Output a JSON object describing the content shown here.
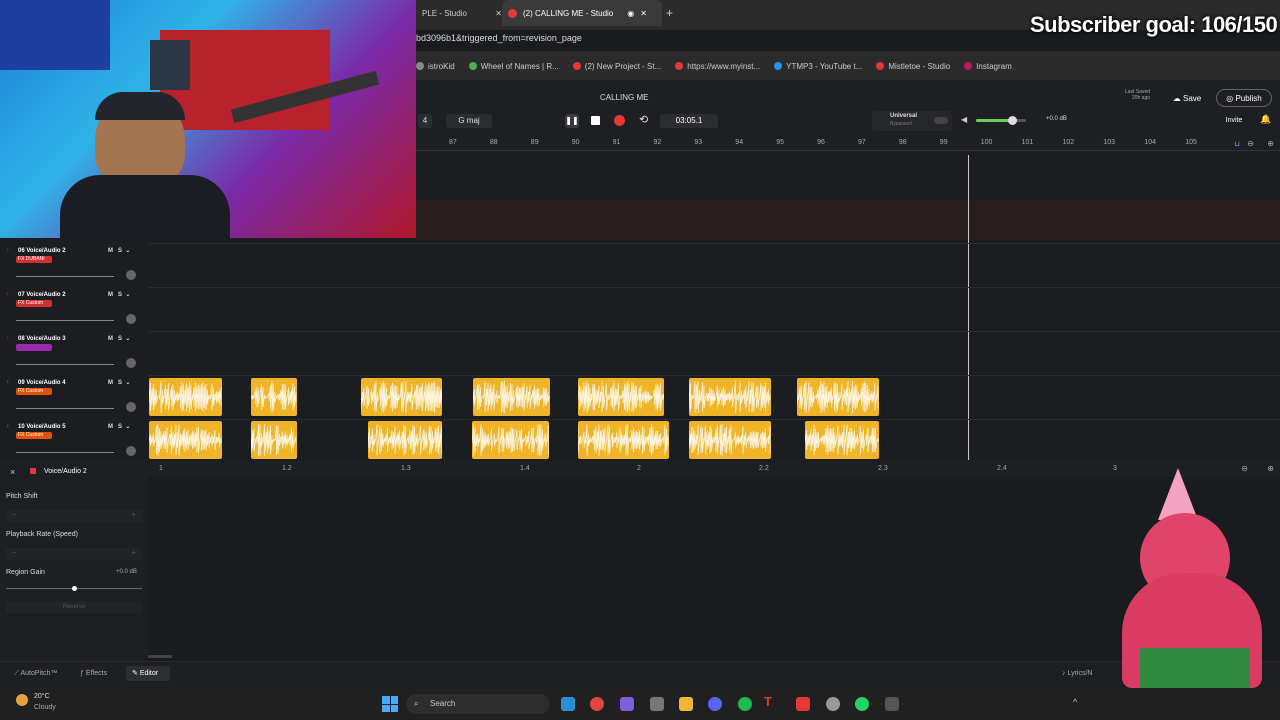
{
  "overlay": {
    "subscriber_goal": "Subscriber goal: 106/150"
  },
  "browser": {
    "tabs": [
      {
        "label": "PLE - Studio"
      },
      {
        "label": "(2) CALLING ME - Studio"
      }
    ],
    "new_tab": "+",
    "url": "bd3096b1&triggered_from=revision_page",
    "bookmarks": [
      {
        "label": "istroKid",
        "color": "#888"
      },
      {
        "label": "Wheel of Names | R...",
        "color": "#4caf50"
      },
      {
        "label": "(2) New Project - St...",
        "color": "#e53935"
      },
      {
        "label": "https://www.myinst...",
        "color": "#e53935"
      },
      {
        "label": "YTMP3 - YouTube t...",
        "color": "#2196f3"
      },
      {
        "label": "Mistletoe - Studio",
        "color": "#e53935"
      },
      {
        "label": "Instagram",
        "color": "#c2185b"
      }
    ]
  },
  "studio": {
    "project_title": "CALLING ME",
    "time_sig": "4",
    "key": "G maj",
    "time": "03:05.1",
    "plugin_name": "Universal",
    "plugin_state": "Bypassed",
    "master_db": "+0.0 dB",
    "last_saved_label": "Last Saved",
    "last_saved_time": "20h ago",
    "save_label": "Save",
    "publish_label": "Publish",
    "invite_label": "Invite",
    "ruler_ticks": [
      "87",
      "88",
      "89",
      "90",
      "91",
      "92",
      "93",
      "94",
      "95",
      "96",
      "97",
      "98",
      "99",
      "100",
      "101",
      "102",
      "103",
      "104",
      "105"
    ]
  },
  "tracks": [
    {
      "num": "06",
      "name": "Voice/Audio 2",
      "fx": "FX DUBANI",
      "fx_color": "#d32f2f"
    },
    {
      "num": "07",
      "name": "Voice/Audio 2",
      "fx": "FX Custom",
      "fx_color": "#d32f2f"
    },
    {
      "num": "08",
      "name": "Voice/Audio 3",
      "fx": "",
      "fx_color": "#9c27b0"
    },
    {
      "num": "09",
      "name": "Voice/Audio 4",
      "fx": "FX Custom",
      "fx_color": "#e65100"
    },
    {
      "num": "10",
      "name": "Voice/Audio 5",
      "fx": "FX Custom",
      "fx_color": "#e65100"
    }
  ],
  "track_buttons": {
    "mute": "M",
    "solo": "S"
  },
  "bottom_ruler": [
    "1",
    "1.2",
    "1.3",
    "1.4",
    "2",
    "2.2",
    "2.3",
    "2.4",
    "3"
  ],
  "editor": {
    "close": "×",
    "track_name": "Voice/Audio 2",
    "pitch_shift_label": "Pitch Shift",
    "playback_rate_label": "Playback Rate (Speed)",
    "region_gain_label": "Region Gain",
    "region_gain_value": "+0.0 dB",
    "reverse_label": "Reverse"
  },
  "bottom_tabs": {
    "autopitch": "AutoPitch™",
    "effects": "Effects",
    "editor": "Editor",
    "lyrics": "Lyrics/N"
  },
  "taskbar": {
    "weather_temp": "20°C",
    "weather_desc": "Cloudy",
    "search_placeholder": "Search"
  }
}
